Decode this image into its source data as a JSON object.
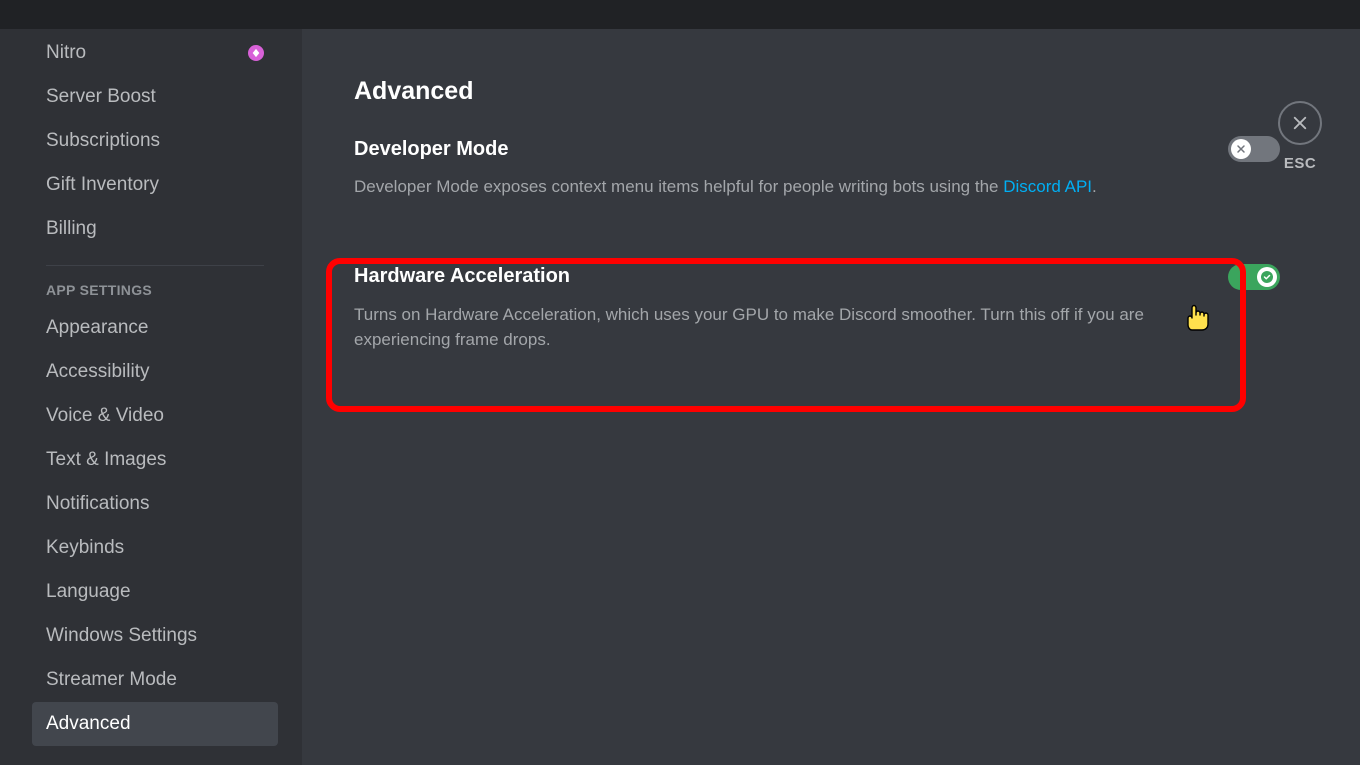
{
  "sidebar": {
    "billing_group": [
      {
        "label": "Nitro",
        "badge": true
      },
      {
        "label": "Server Boost"
      },
      {
        "label": "Subscriptions"
      },
      {
        "label": "Gift Inventory"
      },
      {
        "label": "Billing"
      }
    ],
    "app_header": "APP SETTINGS",
    "app_group": [
      {
        "label": "Appearance"
      },
      {
        "label": "Accessibility"
      },
      {
        "label": "Voice & Video"
      },
      {
        "label": "Text & Images"
      },
      {
        "label": "Notifications"
      },
      {
        "label": "Keybinds"
      },
      {
        "label": "Language"
      },
      {
        "label": "Windows Settings"
      },
      {
        "label": "Streamer Mode"
      },
      {
        "label": "Advanced",
        "selected": true
      }
    ]
  },
  "page": {
    "title": "Advanced",
    "close_label": "ESC"
  },
  "settings": {
    "developer_mode": {
      "title": "Developer Mode",
      "desc_prefix": "Developer Mode exposes context menu items helpful for people writing bots using the ",
      "link_text": "Discord API",
      "desc_suffix": ".",
      "enabled": false
    },
    "hardware_accel": {
      "title": "Hardware Acceleration",
      "desc": "Turns on Hardware Acceleration, which uses your GPU to make Discord smoother. Turn this off if you are experiencing frame drops.",
      "enabled": true
    }
  }
}
